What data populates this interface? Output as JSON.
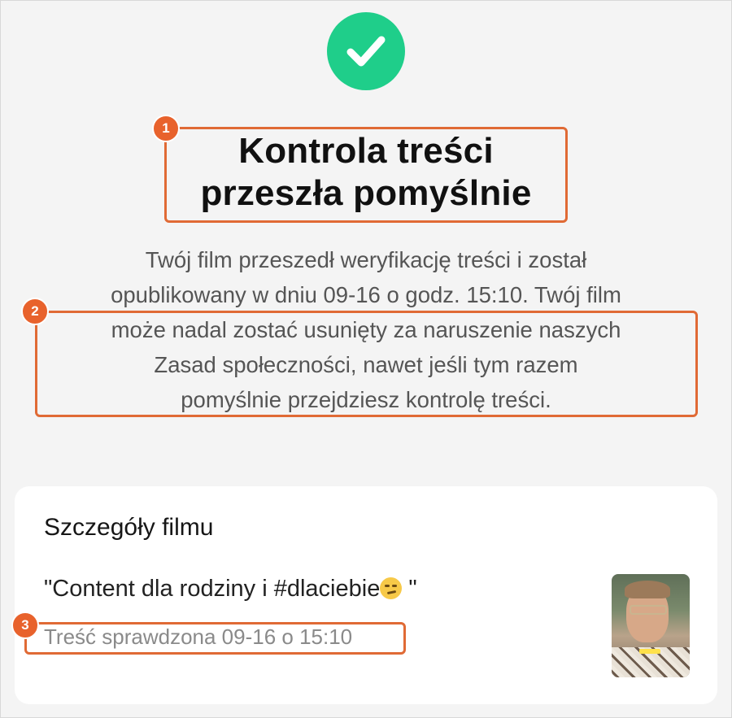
{
  "status": {
    "icon": "checkmark-icon",
    "color": "#1fce8a"
  },
  "title": {
    "line1": "Kontrola treści",
    "line2": "przeszła pomyślnie"
  },
  "description": {
    "lines": [
      "Twój film przeszedł weryfikację treści i został",
      "opublikowany w dniu 09-16 o godz. 15:10. Twój film",
      "może nadal zostać usunięty za naruszenie naszych",
      "Zasad społeczności, nawet jeśli tym razem",
      "pomyślnie przejdziesz kontrolę treści."
    ]
  },
  "annotations": {
    "badge1": "1",
    "badge2": "2",
    "badge3": "3",
    "color": "#e06a35"
  },
  "card": {
    "heading": "Szczegóły filmu",
    "video_title_prefix": "\"Content dla rodziny i #dlaciebie",
    "video_title_emoji": "smirking-face-emoji",
    "video_title_suffix": " \"",
    "review_status": "Treść sprawdzona 09-16 o 15:10",
    "thumbnail": "video-thumbnail"
  }
}
